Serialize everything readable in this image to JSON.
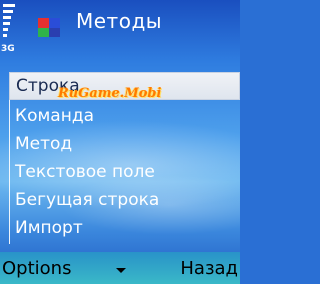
{
  "header": {
    "title": "Методы",
    "network": "3G",
    "app_icon": "flag-app-icon"
  },
  "menu": {
    "items": [
      {
        "label": "Строка",
        "selected": true
      },
      {
        "label": "Команда"
      },
      {
        "label": "Метод"
      },
      {
        "label": "Текстовое поле"
      },
      {
        "label": "Бегущая строка"
      },
      {
        "label": "Импорт"
      }
    ]
  },
  "watermark": "RuGame.Mobi",
  "softkeys": {
    "left": "Options",
    "middle_icon": "chevron-down-icon",
    "right": "Назад"
  },
  "colors": {
    "accent": "#2f7de0",
    "selection_bg": "#e8ecf3",
    "watermark": "#ff7a00"
  }
}
